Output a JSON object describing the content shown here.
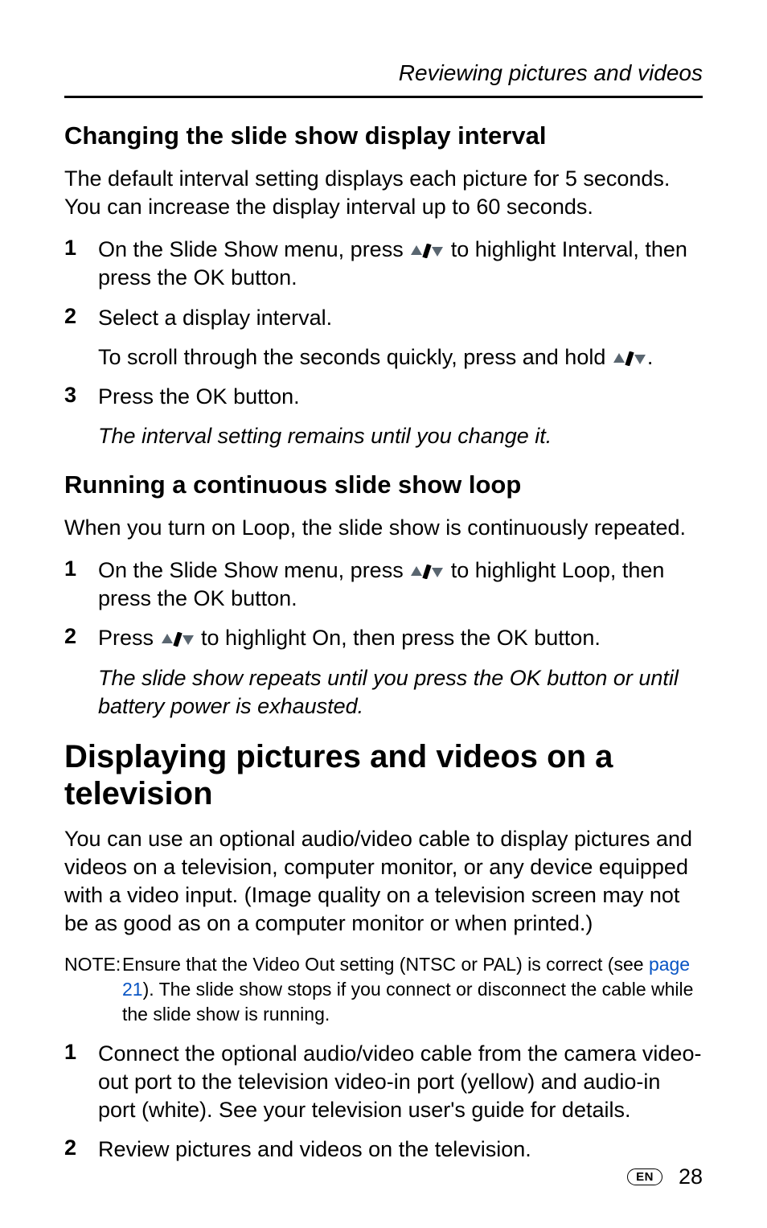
{
  "header": {
    "chapter_title": "Reviewing pictures and videos"
  },
  "section1": {
    "heading": "Changing the slide show display interval",
    "intro": "The default interval setting displays each picture for 5 seconds. You can increase the display interval up to 60 seconds.",
    "steps": [
      {
        "num": "1",
        "pre": "On the Slide Show menu, press ",
        "post": " to highlight Interval, then press the OK button."
      },
      {
        "num": "2",
        "pre": "Select a display interval.",
        "post": ""
      },
      {
        "num": "3",
        "pre": "Press the OK button.",
        "post": ""
      }
    ],
    "scroll_line_pre": "To scroll through the seconds quickly, press and hold ",
    "scroll_line_post": ".",
    "result": "The interval setting remains until you change it."
  },
  "section2": {
    "heading": "Running a continuous slide show loop",
    "intro": "When you turn on Loop, the slide show is continuously repeated.",
    "steps": [
      {
        "num": "1",
        "pre": "On the Slide Show menu, press ",
        "post": " to highlight Loop, then press the OK button."
      },
      {
        "num": "2",
        "pre": "Press ",
        "post": " to highlight On, then press the OK button."
      }
    ],
    "result": "The slide show repeats until you press the OK button or until battery power is exhausted."
  },
  "section3": {
    "heading": "Displaying pictures and videos on a television",
    "intro": "You can use an optional audio/video cable to display pictures and videos on a television, computer monitor, or any device equipped with a video input. (Image quality on a television screen may not be as good as on a computer monitor or when printed.)",
    "note_label": "NOTE:",
    "note_pre": "Ensure that the Video Out setting (NTSC or PAL) is correct (see ",
    "note_link": "page 21",
    "note_post": "). The slide show stops if you connect or disconnect the cable while the slide show is running.",
    "steps": [
      {
        "num": "1",
        "text": "Connect the optional audio/video cable from the camera video-out port to the television video-in port (yellow) and audio-in port (white). See your television user's guide for details."
      },
      {
        "num": "2",
        "text": "Review pictures and videos on the television."
      }
    ]
  },
  "footer": {
    "lang": "EN",
    "page": "28"
  },
  "icons": {
    "updown_slash": "up-down-slash"
  }
}
